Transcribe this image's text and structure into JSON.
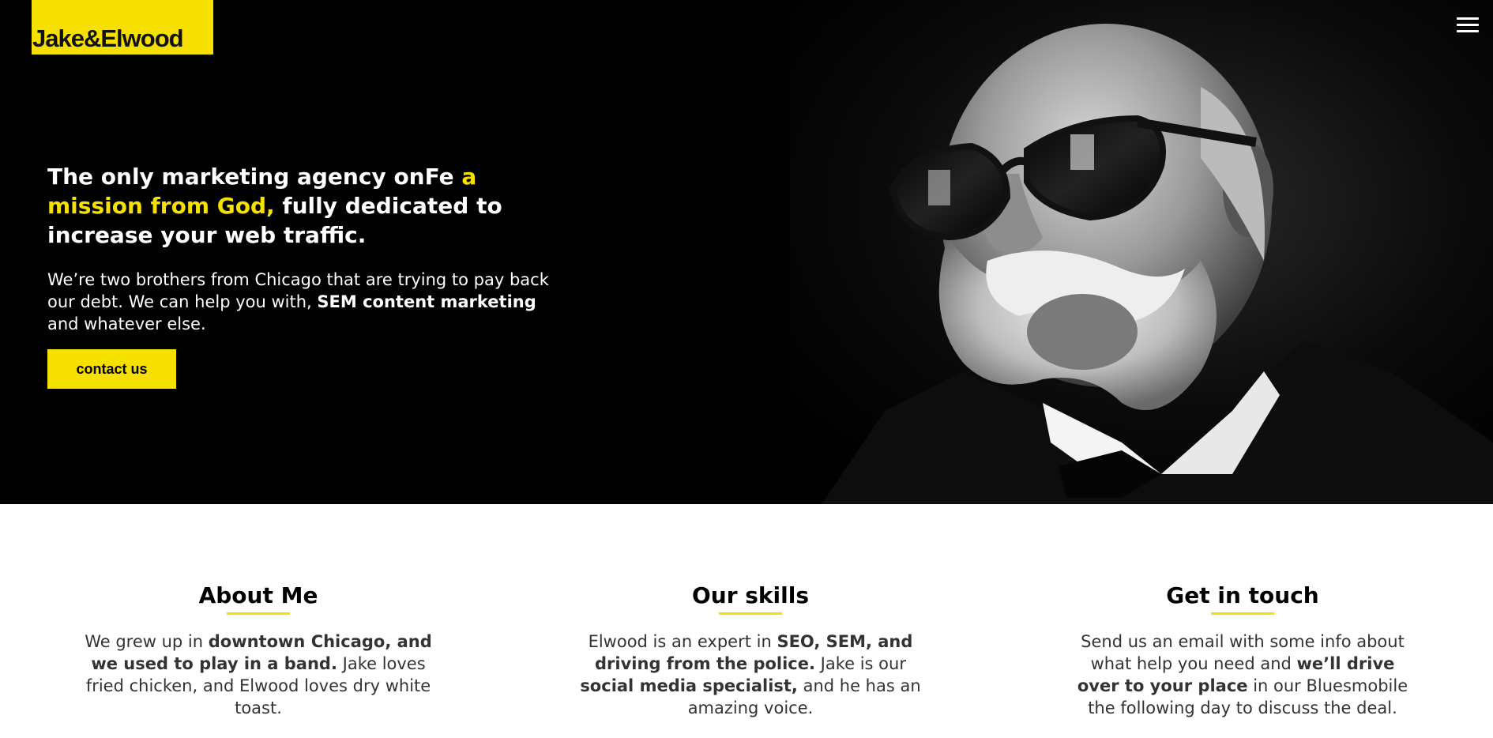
{
  "brand": {
    "logo_text": "Jake&Elwood",
    "accent_color": "#f5e000"
  },
  "header": {
    "menu_icon": "hamburger-menu-icon"
  },
  "hero": {
    "title_part1": "The only marketing agency onFe ",
    "title_highlight": "a mission from God,",
    "title_part2": " fully dedicated to increase your web traffic.",
    "desc_part1": "We’re two brothers from Chicago that are trying to pay back our debt. We can help you with, ",
    "desc_bold": "SEM content marketing",
    "desc_part2": " and whatever else.",
    "cta_label": "contact us"
  },
  "columns": [
    {
      "heading": "About Me",
      "t1": "We grew up in ",
      "b1": "downtown Chicago, and we used to play in a band.",
      "t2": " Jake loves fried chicken, and Elwood loves dry white toast.",
      "b2": "",
      "t3": ""
    },
    {
      "heading": "Our skills",
      "t1": "Elwood is an expert in ",
      "b1": "SEO, SEM, and driving from the police.",
      "t2": " Jake is our ",
      "b2": "social media specialist,",
      "t3": " and he has an amazing voice."
    },
    {
      "heading": "Get in touch",
      "t1": "Send us an email with some info about what help you need and ",
      "b1": "we’ll drive over to your place",
      "t2": " in our Bluesmobile the following day to discuss the deal.",
      "b2": "",
      "t3": ""
    }
  ]
}
